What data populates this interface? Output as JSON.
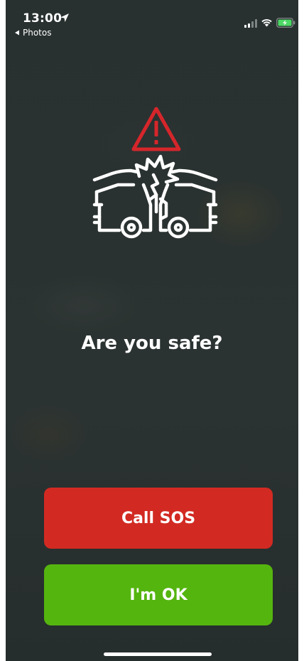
{
  "status_bar": {
    "time": "13:00",
    "back_label": "Photos",
    "icons": [
      "location-arrow-icon",
      "cellular-signal-icon",
      "wifi-icon",
      "battery-charging-icon"
    ]
  },
  "illustration": {
    "icons": [
      "warning-triangle-icon",
      "car-crash-icon"
    ]
  },
  "prompt": {
    "question": "Are you safe?"
  },
  "actions": {
    "call_sos_label": "Call SOS",
    "im_ok_label": "I'm OK"
  },
  "colors": {
    "background": "#2a3231",
    "sos": "#d22a22",
    "ok": "#55b50f",
    "warning": "#d5262b",
    "battery": "#4cd964"
  }
}
